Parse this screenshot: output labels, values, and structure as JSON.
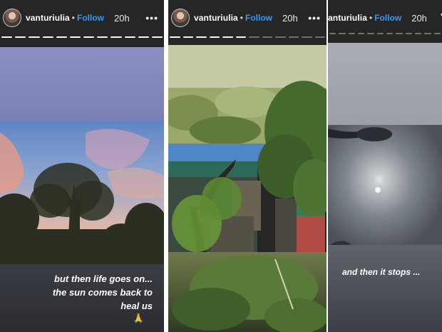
{
  "stories": [
    {
      "username": "vanturiulia",
      "separator": "•",
      "follow_label": "Follow",
      "time": "20h",
      "more_label": "•••",
      "progress_segments": 12,
      "progress_active": 12,
      "caption": [
        "but then  life goes on...",
        "the sun comes back to",
        "heal us"
      ],
      "emoji": "🙏"
    },
    {
      "username": "vanturiulia",
      "separator": "•",
      "follow_label": "Follow",
      "time": "20h",
      "more_label": "•••",
      "progress_segments": 12,
      "progress_active": 6
    },
    {
      "username": "anturiulia",
      "separator": "•",
      "follow_label": "Follow",
      "time": "20h",
      "more_label": "•",
      "progress_segments": 12,
      "progress_active": 0,
      "caption": [
        "and then  it stops ..."
      ]
    }
  ],
  "colors": {
    "follow": "#3897f0",
    "panel_bg": "#262626",
    "roof": "#4f86c6"
  }
}
